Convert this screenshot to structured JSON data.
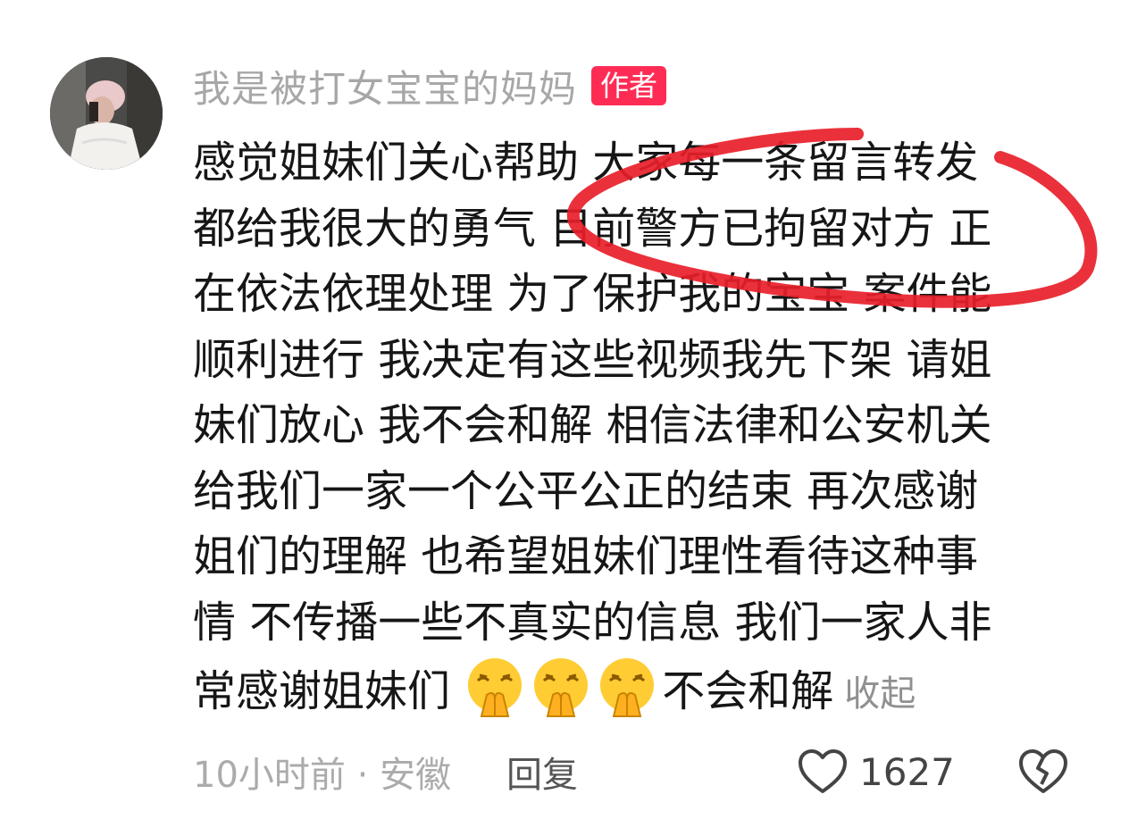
{
  "comment": {
    "author": "我是被打女宝宝的妈妈",
    "badge": "作者",
    "lines": [
      "感觉姐妹们关心帮助 大家每一条留言转发",
      "都给我很大的勇气 目前警方已拘留对方 正",
      "在依法依理处理 为了保护我的宝宝 案件能",
      "顺利进行 我决定有这些视频我先下架  请姐",
      "妹们放心 我不会和解 相信法律和公安机关",
      "给我们一家一个公平公正的结束 再次感谢",
      "姐们的理解 也希望姐妹们理性看待这种事",
      "情 不传播一些不真实的信息 我们一家人非"
    ],
    "last_line_start": "常感谢姐妹们 ",
    "last_line_end": "不会和解",
    "emoji_name": "pray-face-emoji",
    "collapse_label": "收起",
    "time_location": "10小时前 · 安徽",
    "reply_label": "回复",
    "like_count": "1627",
    "accent_color": "#fe2c55",
    "annotation_color": "#e8202a"
  }
}
